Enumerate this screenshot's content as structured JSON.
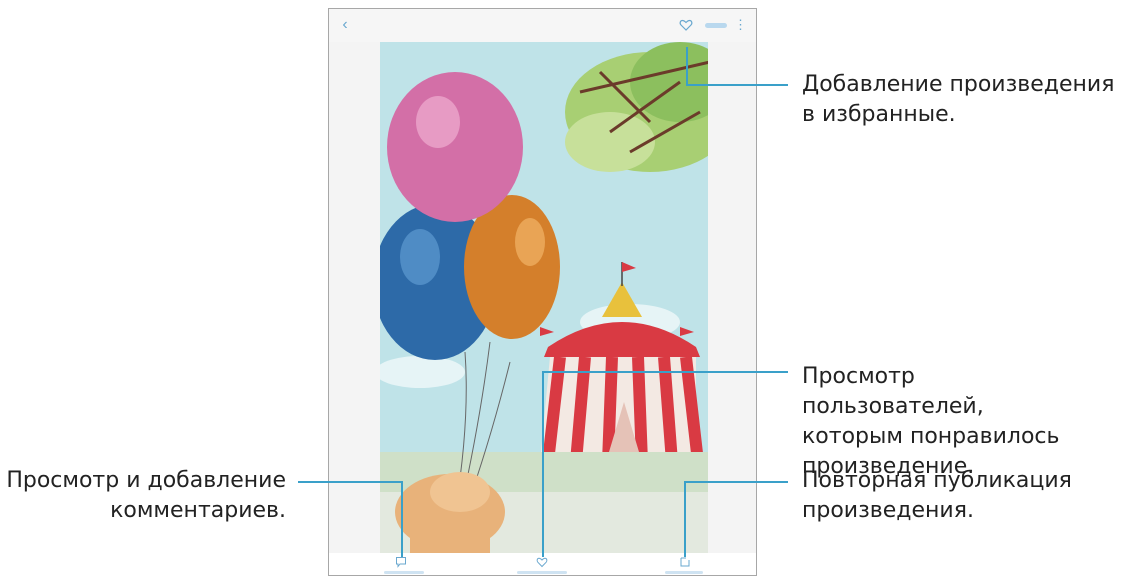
{
  "device": {
    "icons": {
      "back": "back-chevron-icon",
      "favorite": "heart-icon",
      "more": "more-vertical-icon",
      "comment": "comment-bubble-icon",
      "likes": "heart-icon",
      "repost": "repost-icon"
    }
  },
  "callouts": {
    "favorite": "Добавление произведения в избранные.",
    "likes": "Просмотр пользователей, которым понравилось произведение.",
    "comments": "Просмотр и добавление комментариев.",
    "repost": "Повторная публикация произведения."
  },
  "colors": {
    "accent": "#3aa0c9",
    "icon": "#6aa8cf"
  }
}
